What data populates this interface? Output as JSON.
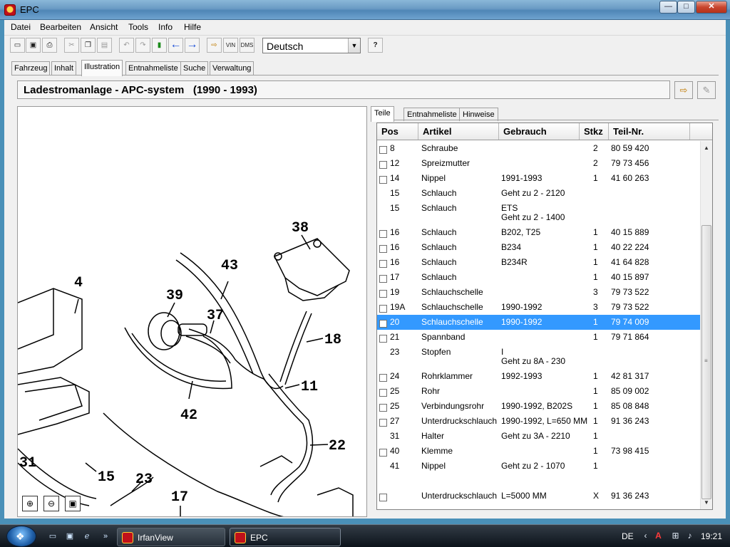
{
  "window": {
    "title": "EPC",
    "min_glyph": "—",
    "max_glyph": "□",
    "close_glyph": "✕"
  },
  "menu": [
    "Datei",
    "Bearbeiten",
    "Ansicht",
    "Tools",
    "Info",
    "Hilfe"
  ],
  "toolbar": {
    "language": "Deutsch",
    "vin_label": "VIN",
    "dms_label": "DMS",
    "help_glyph": "?"
  },
  "main_tabs": [
    "Fahrzeug",
    "Inhalt",
    "Illustration",
    "Entnahmeliste",
    "Suche",
    "Verwaltung"
  ],
  "active_main_tab": "Illustration",
  "heading": "Ladestromanlage - APC-system   (1990 - 1993)",
  "illustration": {
    "callouts": [
      "38",
      "43",
      "4",
      "39",
      "37",
      "18",
      "11",
      "42",
      "22",
      "31",
      "15",
      "23",
      "17"
    ]
  },
  "sub_tabs": [
    "Teile",
    "Entnahmeliste",
    "Hinweise"
  ],
  "active_sub_tab": "Teile",
  "table": {
    "columns": [
      "Pos",
      "Artikel",
      "Gebrauch",
      "Stkz",
      "Teil-Nr."
    ],
    "rows": [
      {
        "cb": true,
        "pos": "8",
        "artikel": "Schraube",
        "gebrauch": "",
        "stkz": "2",
        "teil": "80 59 420"
      },
      {
        "cb": true,
        "pos": "12",
        "artikel": "Spreizmutter",
        "gebrauch": "",
        "stkz": "2",
        "teil": "79 73 456"
      },
      {
        "cb": true,
        "pos": "14",
        "artikel": "Nippel",
        "gebrauch": "1991-1993",
        "stkz": "1",
        "teil": "41 60 263"
      },
      {
        "cb": false,
        "pos": "15",
        "artikel": "Schlauch",
        "gebrauch": "Geht zu 2 - 2120",
        "stkz": "",
        "teil": ""
      },
      {
        "cb": false,
        "pos": "15",
        "artikel": "Schlauch",
        "gebrauch": "ETS",
        "gebrauch2": "Geht zu 2 - 1400",
        "stkz": "",
        "teil": ""
      },
      {
        "cb": true,
        "pos": "16",
        "artikel": "Schlauch",
        "gebrauch": "B202, T25",
        "stkz": "1",
        "teil": "40 15 889"
      },
      {
        "cb": true,
        "pos": "16",
        "artikel": "Schlauch",
        "gebrauch": "B234",
        "stkz": "1",
        "teil": "40 22 224"
      },
      {
        "cb": true,
        "pos": "16",
        "artikel": "Schlauch",
        "gebrauch": "B234R",
        "stkz": "1",
        "teil": "41 64 828"
      },
      {
        "cb": true,
        "pos": "17",
        "artikel": "Schlauch",
        "gebrauch": "",
        "stkz": "1",
        "teil": "40 15 897"
      },
      {
        "cb": true,
        "pos": "19",
        "artikel": "Schlauchschelle",
        "gebrauch": "",
        "stkz": "3",
        "teil": "79 73 522"
      },
      {
        "cb": true,
        "pos": "19A",
        "artikel": "Schlauchschelle",
        "gebrauch": "1990-1992",
        "stkz": "3",
        "teil": "79 73 522"
      },
      {
        "cb": true,
        "pos": "20",
        "artikel": "Schlauchschelle",
        "gebrauch": "1990-1992",
        "stkz": "1",
        "teil": "79 74 009",
        "selected": true
      },
      {
        "cb": true,
        "pos": "21",
        "artikel": "Spannband",
        "gebrauch": "",
        "stkz": "1",
        "teil": "79 71 864"
      },
      {
        "cb": false,
        "pos": "23",
        "artikel": "Stopfen",
        "gebrauch": "I",
        "gebrauch2": "Geht zu 8A - 230",
        "stkz": "",
        "teil": ""
      },
      {
        "cb": true,
        "pos": "24",
        "artikel": "Rohrklammer",
        "gebrauch": "1992-1993",
        "stkz": "1",
        "teil": "42 81 317"
      },
      {
        "cb": true,
        "pos": "25",
        "artikel": "Rohr",
        "gebrauch": "",
        "stkz": "1",
        "teil": "85 09 002"
      },
      {
        "cb": true,
        "pos": "25",
        "artikel": "Verbindungsrohr",
        "gebrauch": "1990-1992, B202S",
        "stkz": "1",
        "teil": "85 08 848"
      },
      {
        "cb": true,
        "pos": "27",
        "artikel": "Unterdruckschlauch",
        "gebrauch": "1990-1992, L=650 MM",
        "stkz": "1",
        "teil": "91 36 243"
      },
      {
        "cb": false,
        "pos": "31",
        "artikel": "Halter",
        "gebrauch": "Geht zu 3A - 2210",
        "stkz": "1",
        "teil": ""
      },
      {
        "cb": true,
        "pos": "40",
        "artikel": "Klemme",
        "gebrauch": "",
        "stkz": "1",
        "teil": "73 98 415"
      },
      {
        "cb": false,
        "pos": "41",
        "artikel": "Nippel",
        "gebrauch": "Geht zu 2 - 1070",
        "stkz": "1",
        "teil": ""
      },
      {
        "cb": true,
        "pos": "",
        "artikel": "Unterdruckschlauch",
        "gebrauch": "L=5000 MM",
        "stkz": "X",
        "teil": "91 36 243"
      }
    ]
  },
  "taskbar": {
    "apps": [
      {
        "label": "IrfanView",
        "active": false
      },
      {
        "label": "EPC",
        "active": true
      }
    ],
    "language": "DE",
    "clock": "19:21"
  },
  "colors": {
    "selection": "#3399ff",
    "titlebar": "#6a9bc4"
  }
}
